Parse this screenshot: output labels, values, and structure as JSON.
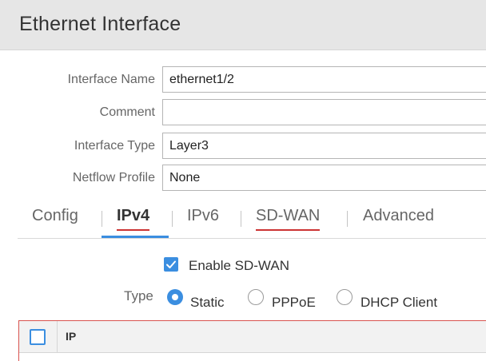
{
  "dialog": {
    "title": "Ethernet Interface"
  },
  "form": {
    "interface_name": {
      "label": "Interface Name",
      "value": "ethernet1/2"
    },
    "comment": {
      "label": "Comment",
      "value": ""
    },
    "interface_type": {
      "label": "Interface Type",
      "value": "Layer3"
    },
    "netflow_profile": {
      "label": "Netflow Profile",
      "value": "None"
    }
  },
  "tabs": [
    {
      "label": "Config",
      "active": false
    },
    {
      "label": "IPv4",
      "active": true
    },
    {
      "label": "IPv6",
      "active": false
    },
    {
      "label": "SD-WAN",
      "active": false
    },
    {
      "label": "Advanced",
      "active": false
    }
  ],
  "sdwan": {
    "enable_label": "Enable SD-WAN",
    "checked": true
  },
  "type": {
    "label": "Type",
    "options": [
      {
        "label": "Static",
        "selected": true
      },
      {
        "label": "PPPoE",
        "selected": false
      },
      {
        "label": "DHCP Client",
        "selected": false
      }
    ]
  },
  "ip_table": {
    "columns": [
      "IP"
    ]
  },
  "colors": {
    "accent": "#3b8ee0",
    "spellcheck": "#cc3333",
    "error_border": "#d9534f",
    "header_bg": "#e6e6e6"
  },
  "icons": {
    "checkbox": "check-icon"
  }
}
